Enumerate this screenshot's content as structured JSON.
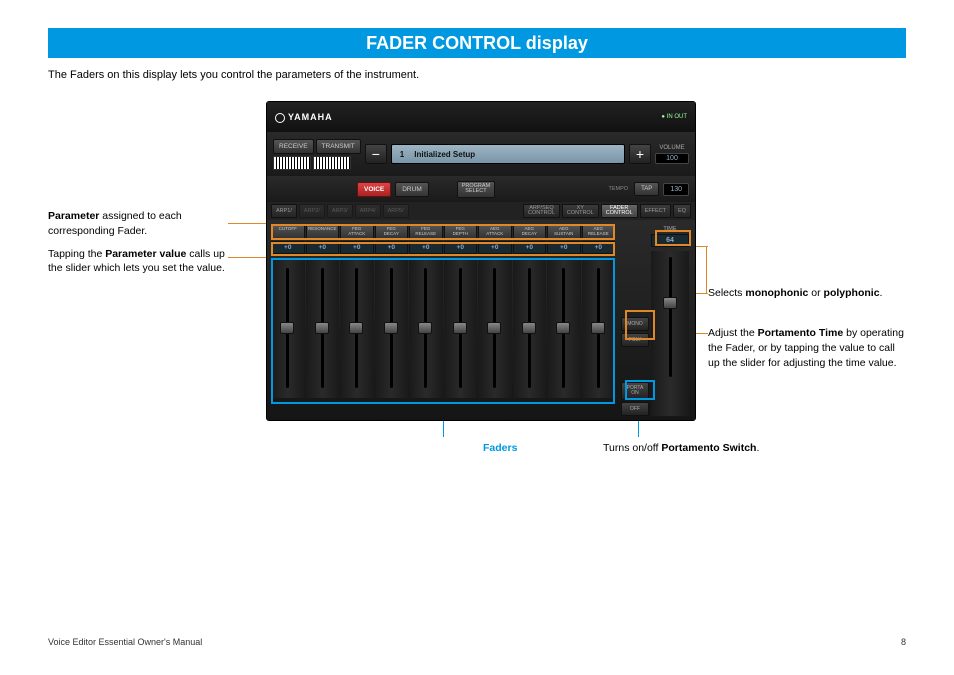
{
  "title": "FADER CONTROL display",
  "intro": "The Faders on this display lets you control the parameters of the instrument.",
  "leftNote": {
    "line1a": "Parameter",
    "line1b": " assigned to each corresponding Fader.",
    "line2a": "Tapping the ",
    "line2b": "Parameter value",
    "line2c": " calls up the slider which lets you set the value."
  },
  "rightNotes": {
    "monoPoly": {
      "a": "Selects ",
      "b": "monophonic",
      "c": " or ",
      "d": "polyphonic",
      "e": "."
    },
    "porta": {
      "a": "Adjust the ",
      "b": "Portamento Time",
      "c": " by operating the Fader, or by tapping the value to call up the slider for adjusting the time value."
    }
  },
  "belowLabels": {
    "faders": "Faders",
    "portaSwitch": {
      "a": "Turns on/off ",
      "b": "Portamento Switch",
      "c": "."
    }
  },
  "device": {
    "brand": "YAMAHA",
    "io": "IN OUT",
    "topButtons": {
      "receive": "RECEIVE",
      "transmit": "TRANSMIT"
    },
    "minus": "−",
    "plus": "+",
    "lcd": {
      "num": "1",
      "name": "Initialized Setup"
    },
    "volume": {
      "label": "VOLUME",
      "val": "100"
    },
    "row3": {
      "voice": "VOICE",
      "drum": "DRUM",
      "program": "PROGRAM\nSELECT",
      "tempoLabel": "TEMPO",
      "tap": "TAP",
      "tempoVal": "130"
    },
    "tabs": [
      "ARP1/",
      "ARP2/",
      "ARP3/",
      "ARP4/",
      "ARP5/",
      "",
      "ARP/SEQ\nCONTROL",
      "XY\nCONTROL",
      "FADER\nCONTROL",
      "EFFECT",
      "EQ"
    ],
    "tabActive": 8,
    "params": [
      "CUTOFF",
      "RESONANCE",
      "FEG\nATTACK",
      "FEG\nDECAY",
      "FEG\nRELEASE",
      "FEG\nDEPTH",
      "AEG\nATTACK",
      "AEG\nDECAY",
      "AEG\nSUSTAIN",
      "AEG\nRELEASE"
    ],
    "values": [
      "+0",
      "+0",
      "+0",
      "+0",
      "+0",
      "+0",
      "+0",
      "+0",
      "+0",
      "+0"
    ],
    "rightCol": {
      "mono": "MONO",
      "poly": "POLY",
      "portaOn": "PORTA\nON",
      "off": "OFF",
      "time": "TIME",
      "timeVal": "64"
    }
  },
  "footer": {
    "left": "Voice Editor Essential Owner's Manual",
    "right": "8"
  }
}
